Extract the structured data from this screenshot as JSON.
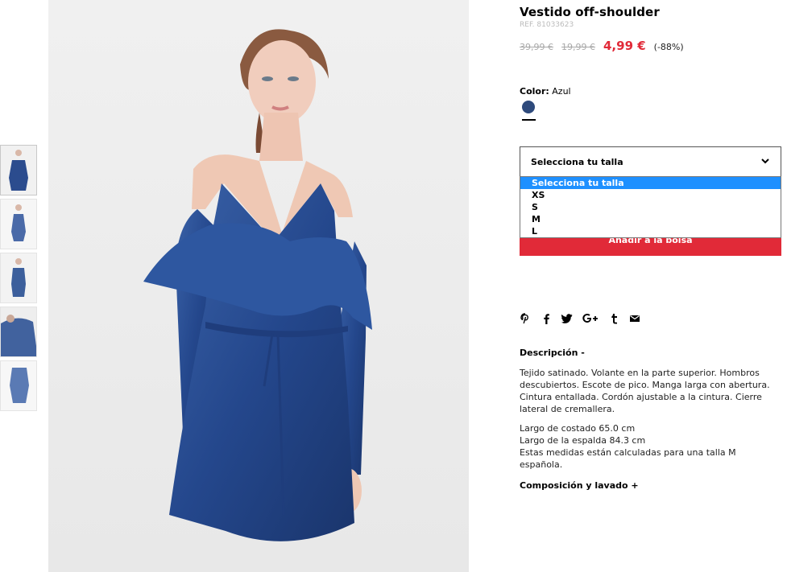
{
  "product": {
    "title": "Vestido off-shoulder",
    "ref": "REF. 81033623",
    "old_price_1": "39,99 €",
    "old_price_2": "19,99 €",
    "sale_price": "4,99 €",
    "discount": "(-88%)"
  },
  "color": {
    "label": "Color:",
    "value": "Azul",
    "swatch_color": "#2e4a7c"
  },
  "size": {
    "select_label": "Selecciona tu talla",
    "options": [
      "Selecciona tu talla",
      "XS",
      "S",
      "M",
      "L"
    ],
    "selected_index": 0
  },
  "add_to_bag": "Añadir a la bolsa",
  "share_icons": [
    "pinterest-icon",
    "facebook-icon",
    "twitter-icon",
    "google-plus-icon",
    "tumblr-icon",
    "email-icon"
  ],
  "description": {
    "title": "Descripción -",
    "text": "Tejido satinado. Volante en la parte superior. Hombros descubiertos. Escote de pico. Manga larga con abertura. Cintura entallada. Cordón ajustable a la cintura. Cierre lateral de cremallera.",
    "measures": [
      "Largo de costado 65.0 cm",
      "Largo de la espalda 84.3 cm",
      "Estas medidas están calculadas para una talla M española."
    ]
  },
  "composition_title": "Composición y lavado +",
  "colors": {
    "accent_red": "#e12a38",
    "dress_blue": "#2b4c8e",
    "dropdown_highlight": "#1e90ff"
  }
}
